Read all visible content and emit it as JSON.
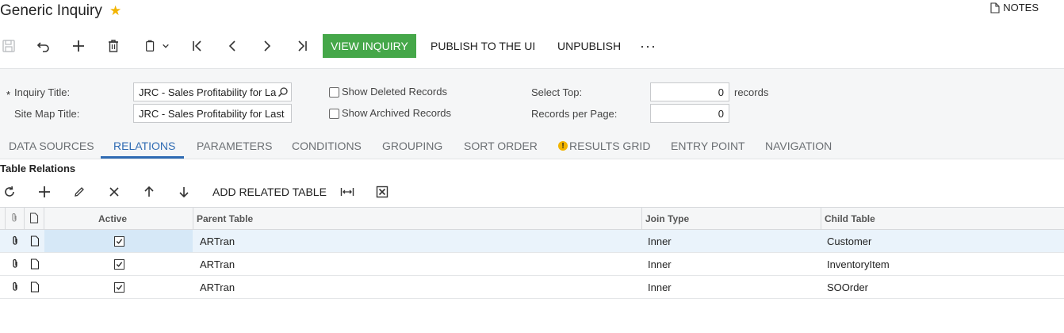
{
  "header": {
    "title": "Generic Inquiry",
    "favorite_icon": "star-icon",
    "notes_label": "NOTES"
  },
  "toolbar": {
    "icons": [
      "save-icon",
      "undo-icon",
      "add-icon",
      "delete-icon",
      "copy-paste-icon",
      "first-record-icon",
      "previous-record-icon",
      "next-record-icon",
      "last-record-icon"
    ],
    "view_inquiry": "VIEW INQUIRY",
    "publish": "PUBLISH TO THE UI",
    "unpublish": "UNPUBLISH",
    "more": "···",
    "accent_color": "#45a749"
  },
  "form": {
    "inquiry_title_label": "Inquiry Title:",
    "inquiry_title_value": "JRC - Sales Profitability for La",
    "required_mark": "*",
    "site_map_title_label": "Site Map Title:",
    "site_map_title_value": "JRC - Sales Profitability for Last",
    "show_deleted_label": "Show Deleted Records",
    "show_deleted_checked": false,
    "show_archived_label": "Show Archived Records",
    "show_archived_checked": false,
    "select_top_label": "Select Top:",
    "select_top_value": "0",
    "select_top_unit": "records",
    "records_per_page_label": "Records per Page:",
    "records_per_page_value": "0"
  },
  "tabs": [
    {
      "label": "DATA SOURCES",
      "active": false
    },
    {
      "label": "RELATIONS",
      "active": true
    },
    {
      "label": "PARAMETERS",
      "active": false
    },
    {
      "label": "CONDITIONS",
      "active": false
    },
    {
      "label": "GROUPING",
      "active": false
    },
    {
      "label": "SORT ORDER",
      "active": false
    },
    {
      "label": "RESULTS GRID",
      "active": false,
      "warning": true
    },
    {
      "label": "ENTRY POINT",
      "active": false
    },
    {
      "label": "NAVIGATION",
      "active": false
    }
  ],
  "relations": {
    "section_title": "Table Relations",
    "toolbar_icons": [
      "refresh-icon",
      "add-icon",
      "edit-icon",
      "delete-icon",
      "move-up-icon",
      "move-down-icon",
      "fit-columns-icon",
      "export-excel-icon"
    ],
    "add_related_table": "ADD RELATED TABLE",
    "columns": [
      "Active",
      "Parent Table",
      "Join Type",
      "Child Table"
    ],
    "rows": [
      {
        "active": true,
        "parent_table": "ARTran",
        "join_type": "Inner",
        "child_table": "Customer",
        "selected": true
      },
      {
        "active": true,
        "parent_table": "ARTran",
        "join_type": "Inner",
        "child_table": "InventoryItem",
        "selected": false
      },
      {
        "active": true,
        "parent_table": "ARTran",
        "join_type": "Inner",
        "child_table": "SOOrder",
        "selected": false
      }
    ]
  }
}
